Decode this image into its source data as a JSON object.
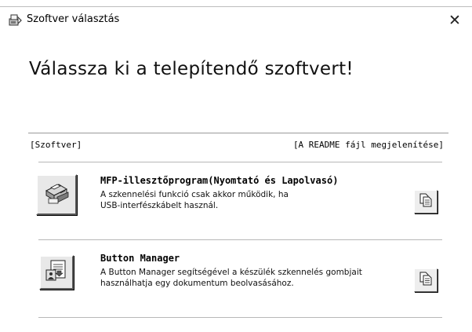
{
  "window": {
    "title": "Szoftver választás",
    "close_glyph": "✕",
    "title_icon": "software-install-icon"
  },
  "heading": "Válassza ki a telepítendő szoftvert!",
  "columns": {
    "left": "[Szoftver]",
    "right": "[A README fájl megjelenítése]"
  },
  "items": [
    {
      "title": "MFP-illesztőprogram(Nyomtató és Lapolvasó)",
      "desc_line1": "A szkennelési funkció csak akkor működik, ha",
      "desc_line2": "USB-interfészkábelt használ.",
      "icon": "printer-scanner-icon",
      "readme_icon": "document-copy-icon"
    },
    {
      "title": "Button Manager",
      "desc_line1": "A Button Manager segítségével a készülék szkennelés gombjait",
      "desc_line2": "használhatja egy dokumentum beolvasásához.",
      "icon": "button-manager-icon",
      "readme_icon": "document-copy-icon"
    }
  ]
}
